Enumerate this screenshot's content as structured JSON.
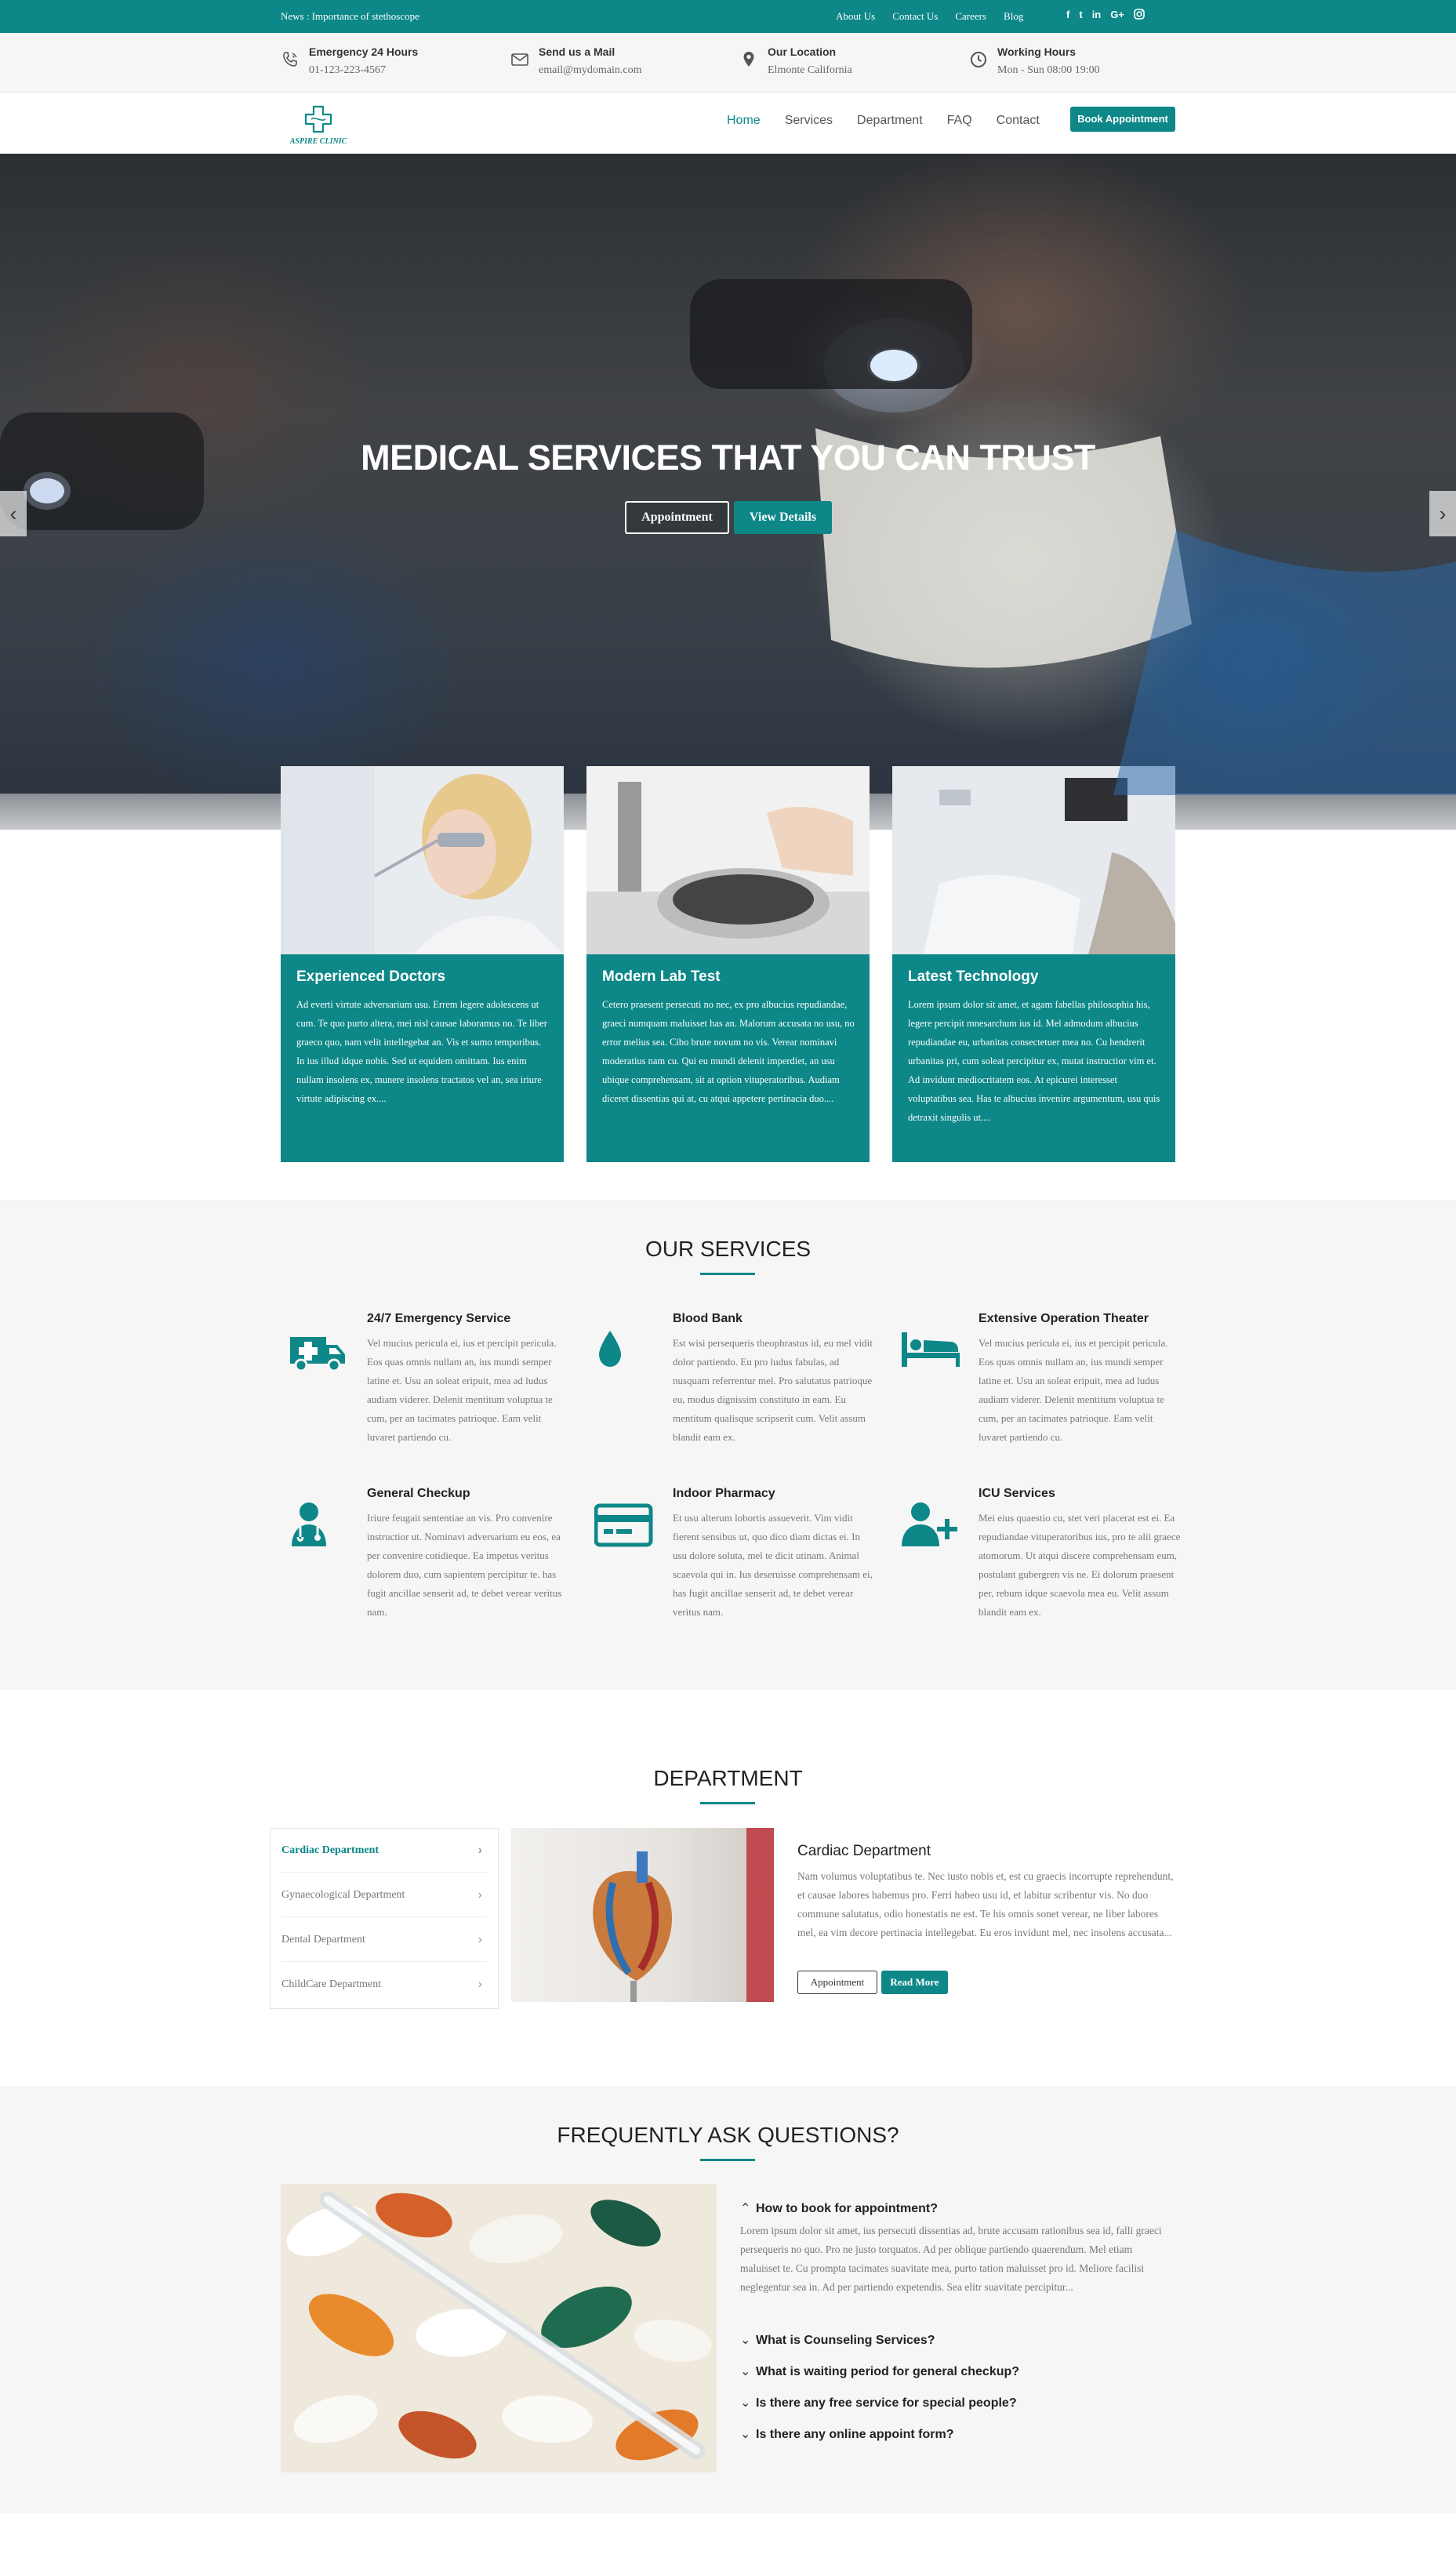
{
  "topbar": {
    "news": "News : Importance of stethoscope",
    "links": [
      "About Us",
      "Contact Us",
      "Careers",
      "Blog"
    ],
    "social": [
      "f",
      "t",
      "in",
      "G+",
      "ig"
    ]
  },
  "info": [
    {
      "icon": "phone-icon",
      "title": "Emergency 24 Hours",
      "value": "01-123-223-4567"
    },
    {
      "icon": "mail-icon",
      "title": "Send us a Mail",
      "value": "email@mydomain.com"
    },
    {
      "icon": "location-pin-icon",
      "title": "Our Location",
      "value": "Elmonte California"
    },
    {
      "icon": "clock-icon",
      "title": "Working Hours",
      "value": "Mon - Sun 08:00 19:00"
    }
  ],
  "nav": {
    "logo_text": "ASPIRE CLINIC",
    "menu": [
      "Home",
      "Services",
      "Department",
      "FAQ",
      "Contact"
    ],
    "book_label": "Book Appointment"
  },
  "hero": {
    "title": "MEDICAL SERVICES THAT YOU CAN TRUST",
    "btn_appointment": "Appointment",
    "btn_details": "View Details",
    "prev": "‹",
    "next": "›"
  },
  "features": [
    {
      "title": "Experienced Doctors",
      "text": "Ad everti virtute adversarium usu. Errem legere adolescens ut cum. Te quo purto altera, mei nisl causae laboramus no. Te liber graeco quo, nam velit intellegebat an. Vis et sumo temporibus. In ius illud idque nobis. Sed ut equidem omittam. Ius enim nullam insolens ex, munere insolens tractatos vel an, sea iriure virtute adipiscing ex...."
    },
    {
      "title": "Modern Lab Test",
      "text": "Cetero praesent persecuti no nec, ex pro albucius repudiandae, graeci numquam maluisset has an. Malorum accusata no usu, no error melius sea. Cibo brute novum no vis. Verear nominavi moderatius nam cu. Qui eu mundi delenit imperdiet, an usu ubique comprehensam, sit at option vituperatoribus. Audiam diceret dissentias qui at, cu atqui appetere pertinacia duo...."
    },
    {
      "title": "Latest Technology",
      "text": "Lorem ipsum dolor sit amet, et agam fabellas philosophia his, legere percipit mnesarchum ius id. Mel admodum albucius repudiandae eu, urbanitas consectetuer mea no. Cu hendrerit urbanitas pri, cum soleat percipitur ex, mutat instructior vim et. Ad invidunt mediocritatem eos. At epicurei interesset voluptatibus sea. Has te albucius invenire argumentum, usu quis detraxit singulis ut...."
    }
  ],
  "services": {
    "title": "OUR SERVICES",
    "items": [
      {
        "icon": "ambulance-icon",
        "title": "24/7 Emergency Service",
        "text": "Vel mucius pericula ei, ius et percipit pericula. Eos quas omnis nullam an, ius mundi semper latine et. Usu an soleat eripuit, mea ad ludus audiam viderer. Delenit mentitum voluptua te cum, per an tacimates patrioque. Eam velit luvaret partiendo cu."
      },
      {
        "icon": "blood-drop-icon",
        "title": "Blood Bank",
        "text": "Est wisi persequeris theophrastus id, eu mel vidit dolor partiendo. Eu pro ludus fabulas, ad nusquam referrentur mel. Pro salutatus patrioque eu, modus dignissim constituto in eam. Eu mentitum qualisque scripserit cum. Velit assum blandit eam ex."
      },
      {
        "icon": "hospital-bed-icon",
        "title": "Extensive Operation Theater",
        "text": "Vel mucius pericula ei, ius et percipit pericula. Eos quas omnis nullam an, ius mundi semper latine et. Usu an soleat eripuit, mea ad ludus audiam viderer. Delenit mentitum voluptua te cum, per an tacimates patrioque. Eam velit luvaret partiendo cu."
      },
      {
        "icon": "doctor-stethoscope-icon",
        "title": "General Checkup",
        "text": "Iriure feugait sententiae an vis. Pro convenire instructior ut. Nominavi adversarium eu eos, ea per convenire cotidieque. Ea impetus veritus dolorem duo, cum sapientem percipitur te. has fugit ancillae senserit ad, te debet verear veritus nam."
      },
      {
        "icon": "card-icon",
        "title": "Indoor Pharmacy",
        "text": "Et usu alterum lobortis assueverit. Vim vidit fierent sensibus ut, quo dico diam dictas ei. In usu dolore soluta, mel te dicit utinam. Animal scaevola qui in. Ius deseruisse comprehensam ei, has fugit ancillae senserit ad, te debet verear veritus nam."
      },
      {
        "icon": "add-user-icon",
        "title": "ICU Services",
        "text": "Mei eius quaestio cu, stet veri placerat est ei. Ea repudiandae vituperatoribus ius, pro te alii graece atomorum. Ut atqui discere comprehensam eum, postulant gubergren vis ne. Ei dolorum praesent per, rebum idque scaevola mea eu. Velit assum blandit eam ex."
      }
    ]
  },
  "department": {
    "title": "DEPARTMENT",
    "list": [
      "Cardiac Department",
      "Gynaecological Department",
      "Dental Department",
      "ChildCare Department"
    ],
    "active": {
      "title": "Cardiac Department",
      "text": "Nam volumus voluptatibus te. Nec iusto nobis et, est cu graecis incorrupte reprehendunt, et causae labores habemus pro. Ferri habeo usu id, et labitur scribentur vis. No duo commune salutatus, odio honestatis ne est. Te his omnis sonet verear, ne liber labores mel, ea vim decore pertinacia intellegebat. Eu eros invidunt mel, nec insolens accusata...",
      "btn_appointment": "Appointment",
      "btn_more": "Read More"
    }
  },
  "faq": {
    "title": "FREQUENTLY ASK QUESTIONS?",
    "open_question": "How to book for appointment?",
    "open_answer": "Lorem ipsum dolor sit amet, ius persecuti dissentias ad, brute accusam rationibus sea id, falli graeci persequeris no quo. Pro ne justo torquatos. Ad per oblique partiendo quaerendum. Mel etiam maluisset te. Cu prompta tacimates suavitate mea, purto tation maluisset pro id. Meliore facilisi neglegentur sea in. Ad per partiendo expetendis. Sea elitr suavitate percipitur...",
    "questions": [
      "What is Counseling Services?",
      "What is waiting period for general checkup?",
      "Is there any free service for special people?",
      "Is there any online appoint form?"
    ]
  },
  "colors": {
    "brand": "#0d8788"
  }
}
